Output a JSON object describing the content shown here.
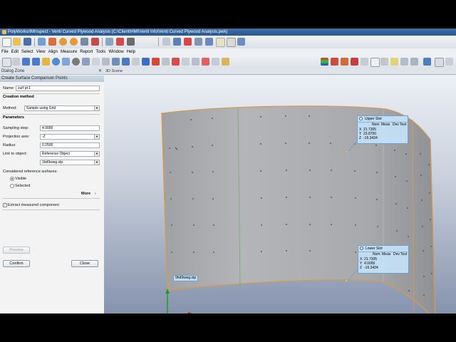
{
  "window": {
    "title": "PolyWorks/IMInspect - Venti Curved Plywood Analysis (C:\\Client\\HMI\\Venti Info\\Venti Curved Plywood Analysis.pwk)"
  },
  "menu": [
    "File",
    "Edit",
    "Select",
    "View",
    "Align",
    "Measure",
    "Report",
    "Tools",
    "Window",
    "Help"
  ],
  "dialog_zone": {
    "title": "Dialog Zone",
    "panel_title": "Create Surface Comparison Points",
    "name_label": "Name:",
    "name_value": "surf pt 1",
    "creation_method_header": "Creation method",
    "method_label": "Method:",
    "method_value": "Sample using Grid",
    "parameters_header": "Parameters",
    "sampling_step_label": "Sampling step:",
    "sampling_step_value": "4.0000",
    "projection_axis_label": "Projection axis:",
    "projection_axis_value": "-Z",
    "radius_label": "Radius:",
    "radius_value": "0.2500",
    "link_label": "Link to object:",
    "link_value": "Reference Object",
    "link_object_value": "1bd9wwg.stp",
    "considered_label": "Considered reference surfaces:",
    "visible_label": "Visible",
    "selected_label": "Selected",
    "more_label": "More",
    "extract_label": "Extract measured component",
    "preview_label": "Preview",
    "confirm_label": "Confirm",
    "close_label": "Close"
  },
  "scene": {
    "tab_label": "3D Scene",
    "upper_slot": {
      "title": "Upper Slot",
      "cols": [
        "Nom",
        "Meas",
        "Dev",
        "Test"
      ],
      "rows": [
        {
          "axis": "X",
          "nom": "21.7305"
        },
        {
          "axis": "Y",
          "nom": "23.8750"
        },
        {
          "axis": "Z",
          "nom": "-16.3434"
        }
      ]
    },
    "lower_slot": {
      "title": "Lower Slot",
      "cols": [
        "Nom",
        "Meas",
        "Dev",
        "Test"
      ],
      "rows": [
        {
          "axis": "X",
          "nom": "21.7305"
        },
        {
          "axis": "Y",
          "nom": "4.0000"
        },
        {
          "axis": "Z",
          "nom": "-16.3434"
        }
      ]
    },
    "object_tag": "9hd9wwg.stp"
  },
  "colors": {
    "title_bar": "#2f5f97",
    "surface": "#a9abae",
    "edge": "#d59a52",
    "triad_x": "#d01818",
    "triad_y": "#18a018",
    "triad_z": "#1838d0"
  }
}
